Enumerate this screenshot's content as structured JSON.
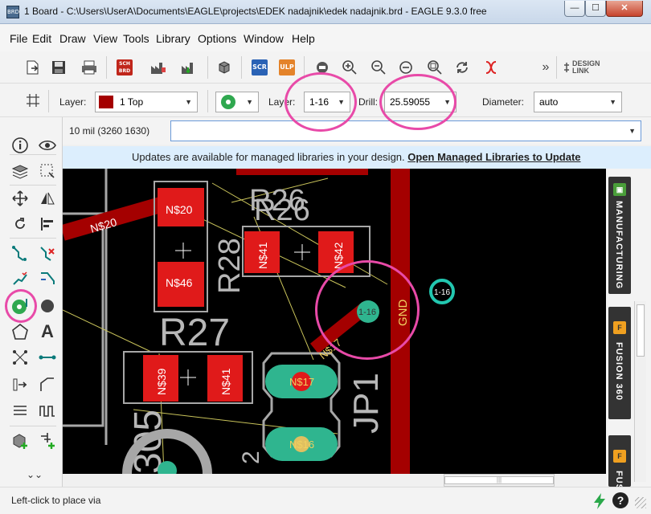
{
  "window": {
    "icon_text": "BRD",
    "title": "1 Board - C:\\Users\\UserA\\Documents\\EAGLE\\projects\\EDEK nadajnik\\edek nadajnik.brd - EAGLE 9.3.0 free",
    "minimize": "—",
    "maximize": "☐",
    "close": "✕"
  },
  "menu": [
    "File",
    "Edit",
    "Draw",
    "View",
    "Tools",
    "Library",
    "Options",
    "Window",
    "Help"
  ],
  "toolbar": {
    "sch_label": "SCH BRD",
    "scr_label": "SCR",
    "ulp_label": "ULP",
    "overflow": "»",
    "design_link": "DESIGN LINK"
  },
  "params": {
    "layer_label": "Layer:",
    "layer_value": "1 Top",
    "via_layer_label": "Layer:",
    "via_layer_value": "1-16",
    "drill_label": "Drill:",
    "drill_value": "25.59055",
    "diameter_label": "Diameter:",
    "diameter_value": "auto"
  },
  "command": {
    "coordinates": "10 mil (3260 1630)",
    "input_value": ""
  },
  "banner": {
    "message": "Updates are available for managed libraries in your design. ",
    "link": "Open Managed Libraries to Update"
  },
  "board": {
    "labels": {
      "r26": "R26",
      "r28": "R28",
      "r27": "R27",
      "jp1": "JP1",
      "gnd": "GND",
      "r305": "305",
      "two": "2"
    },
    "pads": {
      "n20_a": "N$20",
      "n20_b": "N$20",
      "n46": "N$46",
      "n41_a": "N$41",
      "n42": "N$42",
      "n39": "N$39",
      "n41_b": "N$41",
      "n17_pad": "N$17",
      "n17_trace": "N$17",
      "n16": "N$16"
    },
    "via_placed": "1-16",
    "via_cursor": "1-16"
  },
  "right_panel": {
    "manufacturing": "MANUFACTURING",
    "fusion": "FUSION 360",
    "fusion_short": "FUS"
  },
  "status": {
    "hint": "Left-click to place via"
  },
  "colors": {
    "top_layer": "#a40000",
    "pad": "#e01a1a",
    "via": "#2fb58f",
    "highlight": "#e84aa8",
    "banner_bg": "#dceefd"
  }
}
